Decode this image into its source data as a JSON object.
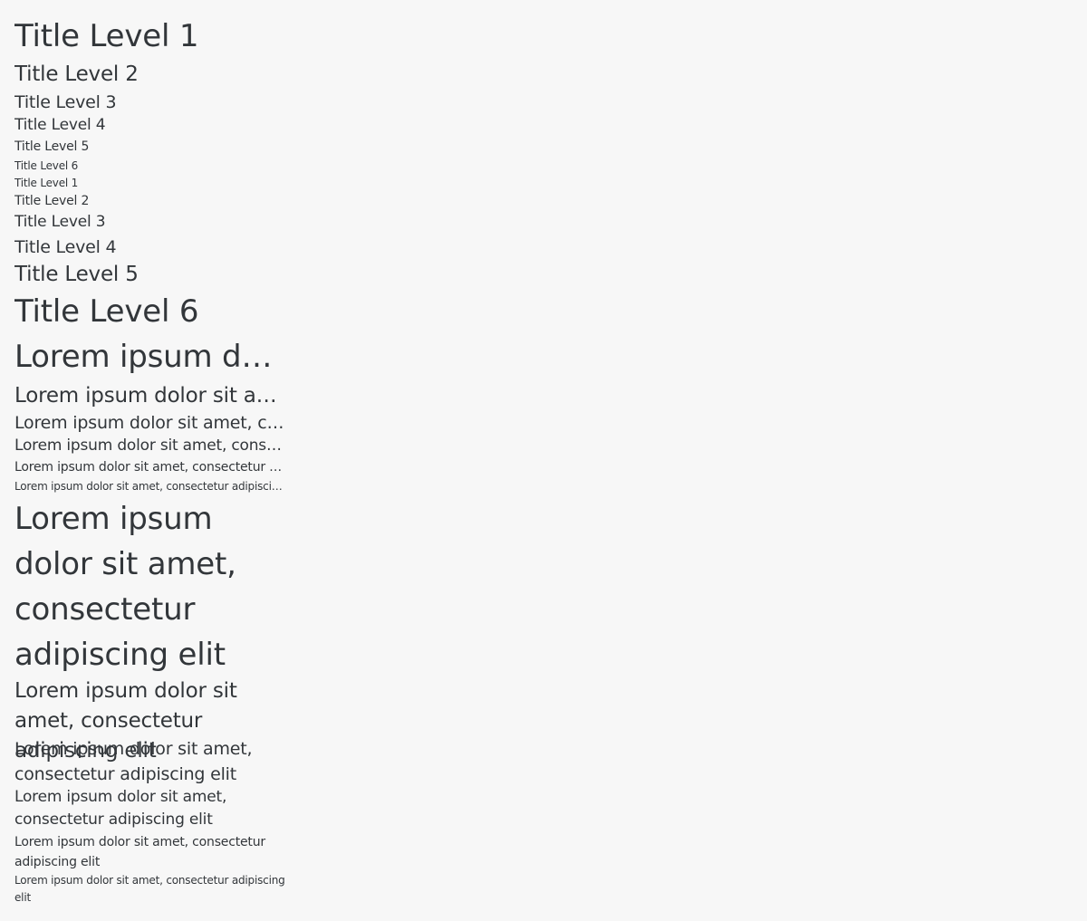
{
  "section_normal": {
    "t1": "Title Level 1",
    "t2": "Title Level 2",
    "t3": "Title Level 3",
    "t4": "Title Level 4",
    "t5": "Title Level 5",
    "t6": "Title Level 6"
  },
  "section_reversed": {
    "t1": "Title Level 1",
    "t2": "Title Level 2",
    "t3": "Title Level 3",
    "t4": "Title Level 4",
    "t5": "Title Level 5",
    "t6": "Title Level 6"
  },
  "section_truncated": {
    "t1": "Lorem ipsum dolor sit amet, consectetur adipiscing elit",
    "t2": "Lorem ipsum dolor sit amet, consectetur adipiscing elit",
    "t3": "Lorem ipsum dolor sit amet, consectetur adipiscing elit",
    "t4": "Lorem ipsum dolor sit amet, consectetur adipiscing elit",
    "t5": "Lorem ipsum dolor sit amet, consectetur adipiscing elit",
    "t6": "Lorem ipsum dolor sit amet, consectetur adipiscing elit"
  },
  "section_wrapped": {
    "t1": "Lorem ipsum dolor sit amet, consectetur adipiscing elit",
    "t2": "Lorem ipsum dolor sit amet, consectetur adipiscing elit",
    "t3": "Lorem ipsum dolor sit amet, consectetur adipiscing elit",
    "t4": "Lorem ipsum dolor sit amet, consectetur adipiscing elit",
    "t5": "Lorem ipsum dolor sit amet, consectetur adipiscing elit",
    "t6": "Lorem ipsum dolor sit amet, consectetur adipiscing elit"
  },
  "colors": {
    "background": "#f7f7f7",
    "text": "#32363a"
  }
}
